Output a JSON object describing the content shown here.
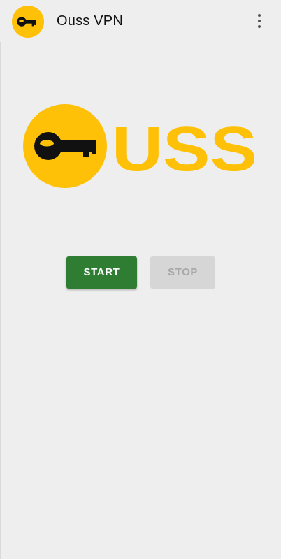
{
  "app": {
    "title": "Ouss VPN",
    "icon": "key-logo-icon",
    "brand_color": "#ffc107"
  },
  "logo": {
    "text": "USS",
    "icon": "key-logo-icon",
    "brand_color": "#ffc107"
  },
  "controls": {
    "start_label": "START",
    "stop_label": "STOP",
    "start_color": "#2e7d32",
    "stop_color": "#d6d6d6",
    "stop_enabled": false
  },
  "menu": {
    "icon": "more-vert-icon"
  }
}
